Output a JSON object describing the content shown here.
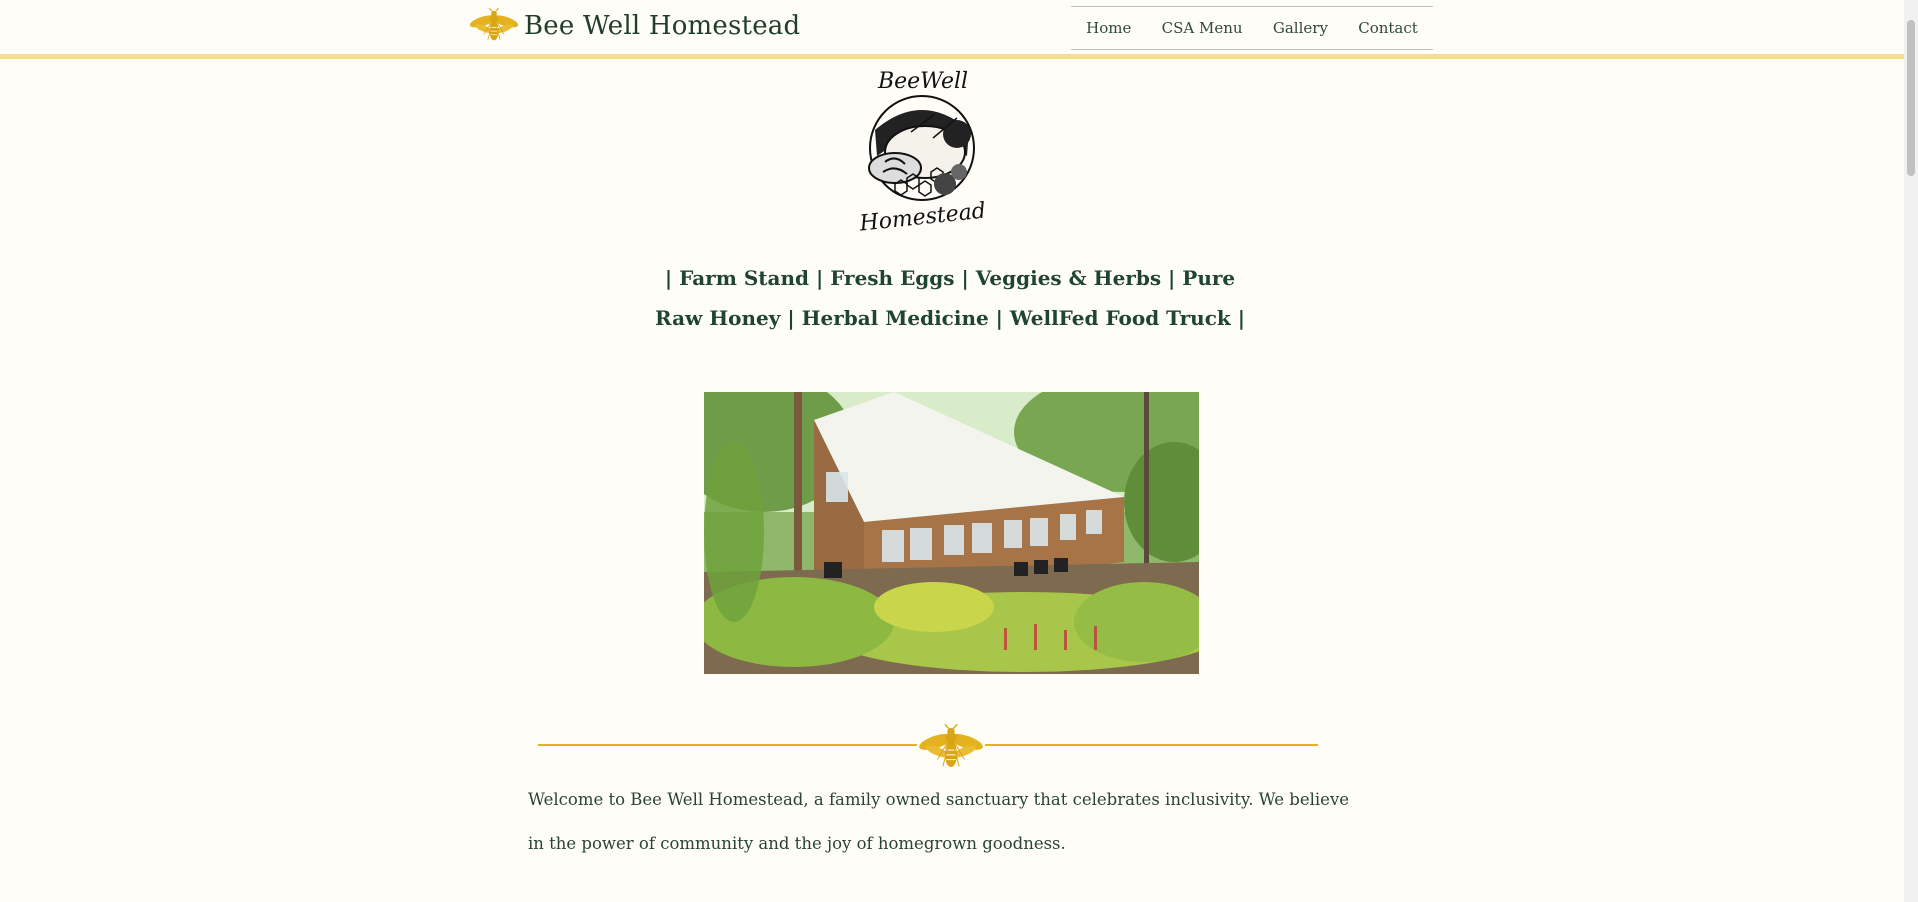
{
  "brand": {
    "title": "Bee Well Homestead",
    "icon": "bee-icon",
    "accent": "#e3b21e"
  },
  "nav": {
    "items": [
      {
        "label": "Home"
      },
      {
        "label": "CSA Menu"
      },
      {
        "label": "Gallery"
      },
      {
        "label": "Contact"
      }
    ]
  },
  "logo": {
    "icon": "bee-well-homestead-logo",
    "text_top": "BeeWell",
    "text_bottom": "Homestead"
  },
  "tagline": {
    "line1": "| Farm Stand | Fresh Eggs | Veggies & Herbs | Pure",
    "line2": "Raw Honey | Herbal Medicine | WellFed Food Truck |"
  },
  "hero": {
    "subject": "greenhouse-garden-photo"
  },
  "welcome": {
    "text": "Welcome to Bee Well Homestead, a family owned sanctuary that celebrates inclusivity. We believe in the power of community and the joy of homegrown goodness."
  },
  "colors": {
    "text": "#1f4530",
    "background": "#fffdf7",
    "gold": "#e3b21e",
    "header_rule": "#f4df8c"
  }
}
